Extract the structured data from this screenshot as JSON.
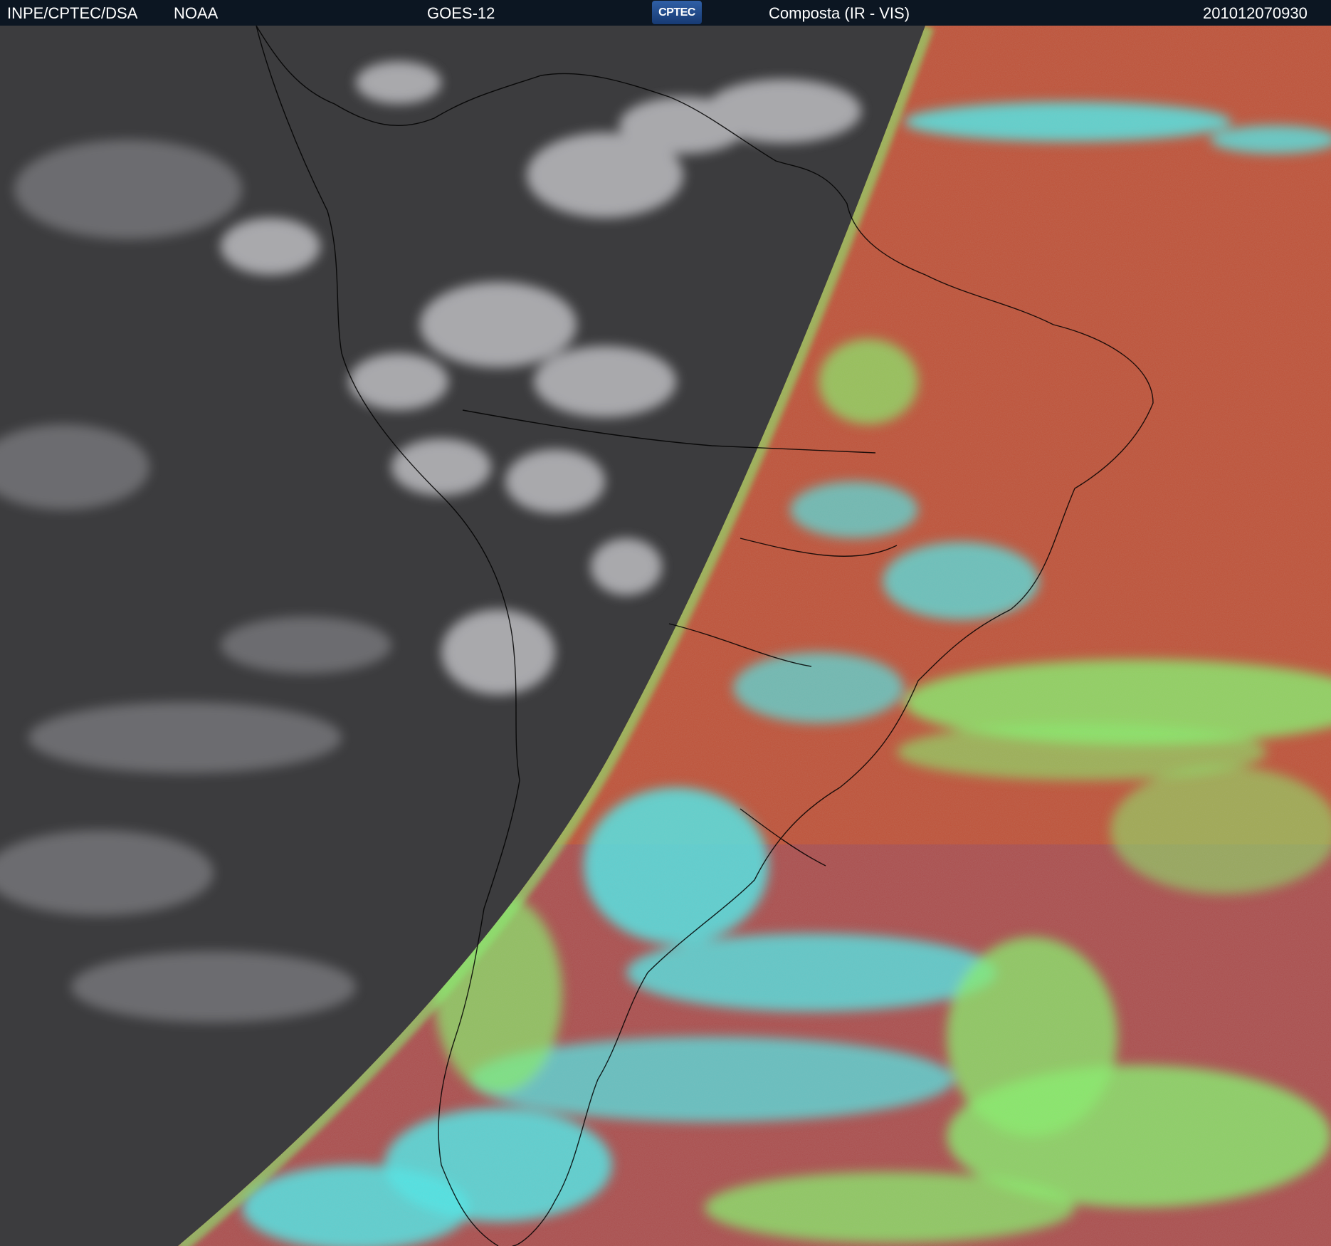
{
  "header": {
    "source": "INPE/CPTEC/DSA",
    "agency": "NOAA",
    "satellite": "GOES-12",
    "logo_text": "CPTEC",
    "product": "Composta (IR - VIS)",
    "timestamp": "201012070930"
  },
  "imagery": {
    "night_region": "infrared grayscale",
    "day_region": "visible color composite",
    "colors": {
      "night_background": "#3c3c3e",
      "night_cloud": "#bcbcc0",
      "day_background": "#bf5238",
      "day_cloud_cyan": "#4fe6e6",
      "day_cloud_green": "#86f06a",
      "coastline": "#000000"
    }
  }
}
